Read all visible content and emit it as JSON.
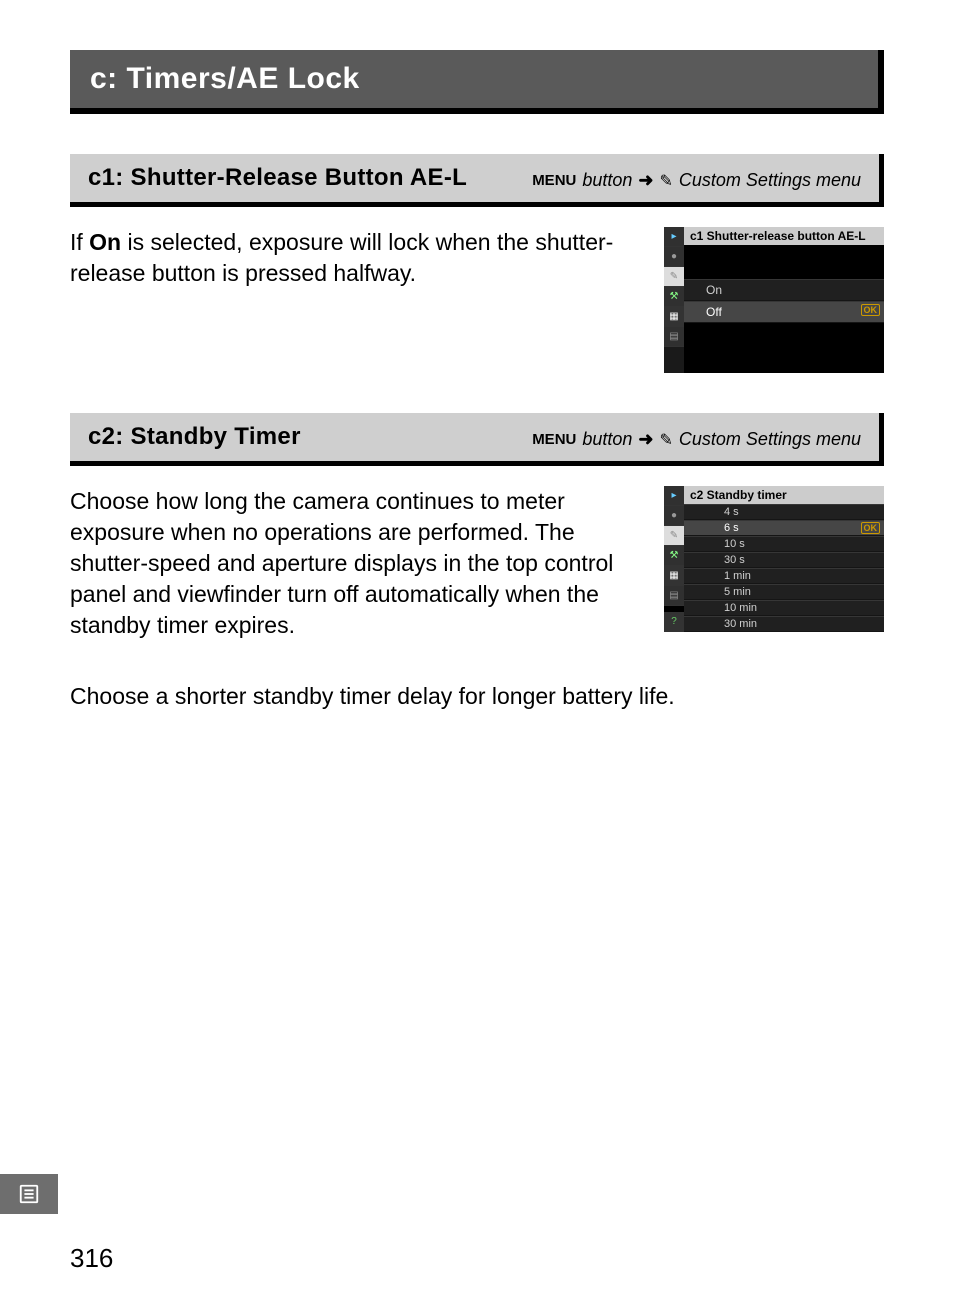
{
  "section_title": "c: Timers/AE Lock",
  "nav": {
    "menu_label": "MENU",
    "button_word": "button",
    "arrow": "➜",
    "pencil": "✎",
    "dest": "Custom Settings menu"
  },
  "c1": {
    "title": "c1: Shutter-Release Button AE-L",
    "body_prefix": "If ",
    "body_bold": "On",
    "body_suffix": " is selected, exposure will lock when the shutter-release button is pressed halfway.",
    "lcd_title": "c1 Shutter-release button AE-L",
    "options": {
      "on": "On",
      "off": "Off"
    },
    "ok": "OK"
  },
  "c2": {
    "title": "c2: Standby Timer",
    "body": "Choose how long the camera continues to meter exposure when no operations are performed.  The shutter-speed and aperture displays in the top control panel and viewfinder turn off automatically when the standby timer expires.",
    "body2": "Choose a shorter standby timer delay for longer battery life.",
    "lcd_title": "c2 Standby timer",
    "options": {
      "o1": "4 s",
      "o2": "6 s",
      "o3": "10 s",
      "o4": "30 s",
      "o5": "1 min",
      "o6": "5 min",
      "o7": "10 min",
      "o8": "30 min"
    },
    "ok": "OK"
  },
  "page_number": "316"
}
